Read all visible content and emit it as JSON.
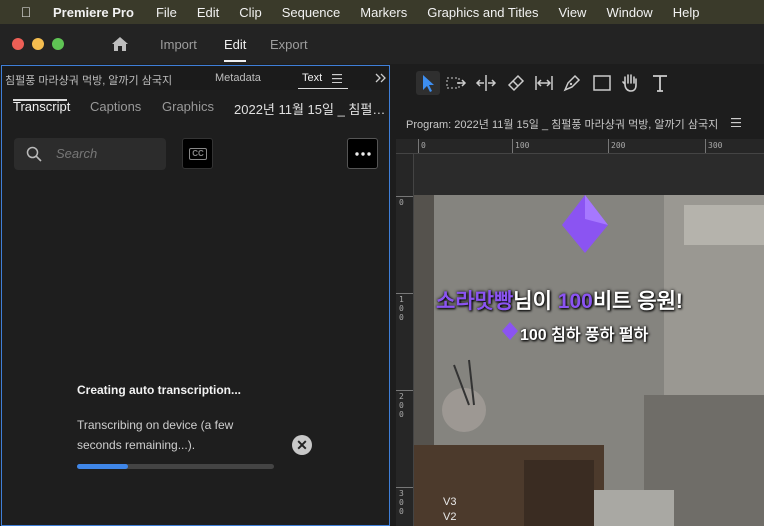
{
  "menubar": {
    "app_name": "Premiere Pro",
    "items": [
      "File",
      "Edit",
      "Clip",
      "Sequence",
      "Markers",
      "Graphics and Titles",
      "View",
      "Window",
      "Help"
    ]
  },
  "workspaces": {
    "import": "Import",
    "edit": "Edit",
    "export": "Export",
    "active": "Edit"
  },
  "left_panel": {
    "project_tab": "침펄풍 마라샹궈 먹방, 알까기 삼국지",
    "metadata_tab": "Metadata",
    "text_tab": "Text",
    "subtabs": {
      "transcript": "Transcript",
      "captions": "Captions",
      "graphics": "Graphics",
      "sequence": "2022년 11월 15일 _ 침펄…"
    },
    "search": {
      "placeholder": "Search"
    },
    "cc_label": "CC",
    "more_label": "•••",
    "status": {
      "title": "Creating auto transcription...",
      "description": "Transcribing on device (a few seconds remaining...).",
      "progress": 0.26
    }
  },
  "program": {
    "title": "Program: 2022년 11월 15일 _ 침펄풍 마라샹궈 먹방, 알까기 삼국지",
    "ruler_h": [
      "0",
      "100",
      "200",
      "300"
    ],
    "ruler_v": [
      "0",
      "1\n0\n0",
      "2\n0\n0",
      "3\n0\n0"
    ],
    "overlay": {
      "name": "소라맛빵",
      "line1_rest": "님이 ",
      "amount": "100",
      "line1_end": "비트 응원!",
      "line2": "100 침하 풍하 펄하"
    },
    "tracks": [
      "V3",
      "V2"
    ]
  },
  "colors": {
    "accent_blue": "#3f86e8",
    "panel_border": "#3f7fd8",
    "highlight_purple": "#8b54f2"
  }
}
